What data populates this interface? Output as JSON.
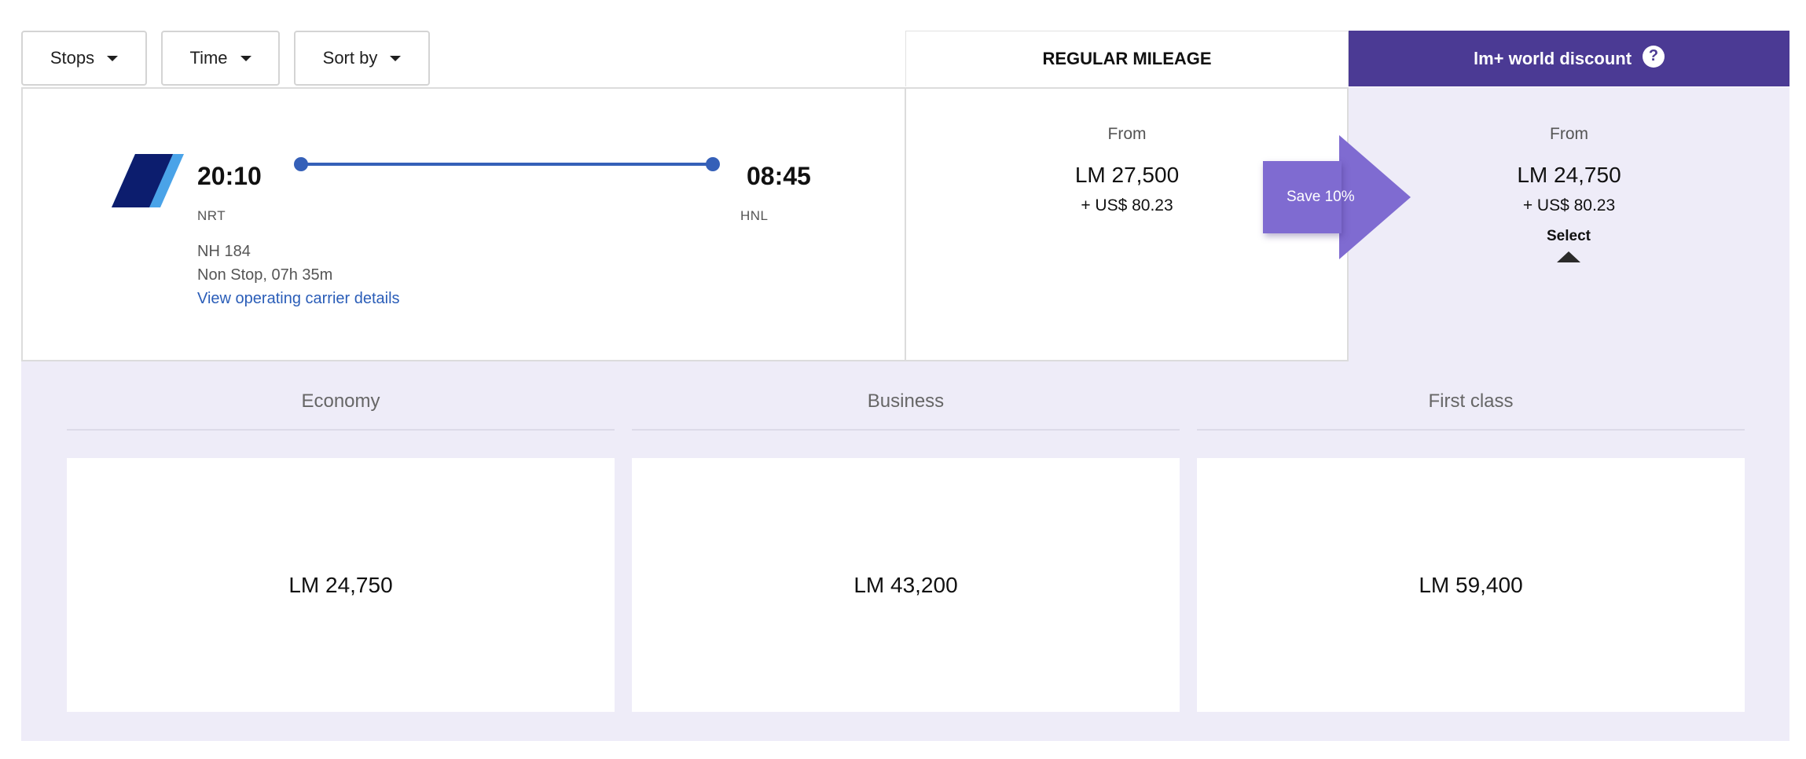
{
  "filters": [
    {
      "label": "Stops"
    },
    {
      "label": "Time"
    },
    {
      "label": "Sort by"
    }
  ],
  "tabs": {
    "regular": "REGULAR MILEAGE",
    "discount": "lm+ world discount",
    "help_icon_glyph": "?"
  },
  "flight": {
    "depart_time": "20:10",
    "arrive_time": "08:45",
    "depart_airport": "NRT",
    "arrive_airport": "HNL",
    "flight_number": "NH 184",
    "duration": "Non Stop, 07h 35m",
    "carrier_link": "View operating carrier details",
    "airline_logo_icon": "airline-logo-icon"
  },
  "regular_price": {
    "from_label": "From",
    "miles": "LM 27,500",
    "cash": "+ US$ 80.23"
  },
  "save_badge": "Save 10%",
  "discount_price": {
    "from_label": "From",
    "miles": "LM 24,750",
    "cash": "+ US$ 80.23",
    "select_label": "Select"
  },
  "cabin_classes": [
    {
      "name": "Economy",
      "price": "LM 24,750"
    },
    {
      "name": "Business",
      "price": "LM 43,200"
    },
    {
      "name": "First class",
      "price": "LM 59,400"
    }
  ],
  "colors": {
    "brand_purple": "#4b3a94",
    "badge_purple": "#7f6bd1",
    "panel_lavender": "#eeecf8",
    "route_blue": "#3560b8",
    "logo_navy": "#0c1d6e",
    "logo_light": "#4aa3e8"
  }
}
